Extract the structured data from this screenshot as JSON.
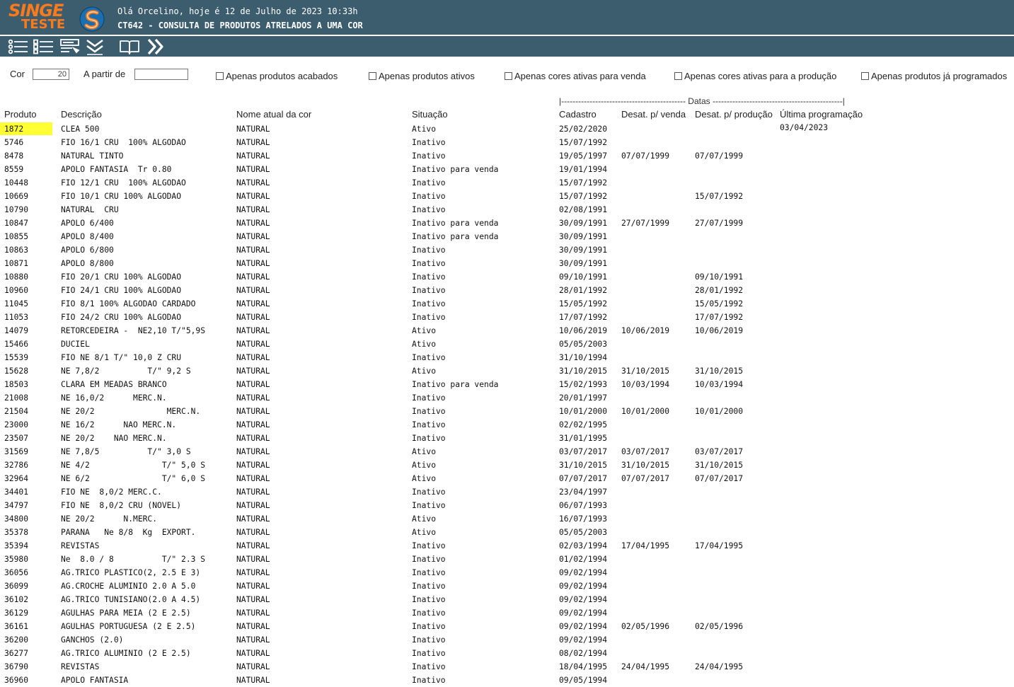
{
  "header": {
    "logo_top": "SINGE",
    "logo_bottom": "TESTE",
    "greeting": "Olá Orcelino, hoje é 12 de Julho de 2023 10:33h",
    "screen_title": "CT642 - CONSULTA DE PRODUTOS ATRELADOS A UMA COR"
  },
  "toolbar": {
    "buttons": [
      "list-icon",
      "checklist-icon",
      "form-icon",
      "double-down-icon",
      "book-icon",
      "forward-icon"
    ]
  },
  "filters": {
    "cor_label": "Cor",
    "cor_value": "20",
    "apartir_label": "A partir de",
    "apartir_value": "",
    "checkboxes": [
      "Apenas produtos acabados",
      "Apenas produtos ativos",
      "Apenas cores ativas para venda",
      "Apenas cores ativas para a produção",
      "Apenas produtos já programados"
    ]
  },
  "table": {
    "datas_group": "|-------------------------------------------- Datas ----------------------------------------------|",
    "headers": [
      "Produto",
      "Descrição",
      "Nome atual da cor",
      "Situação",
      "Cadastro",
      "Desat. p/ venda",
      "Desat. p/ produção",
      "Última programação"
    ],
    "rows": [
      [
        "1872",
        "CLEA 500",
        "NATURAL",
        "Ativo",
        "25/02/2020",
        "",
        "",
        "03/04/2023"
      ],
      [
        "5746",
        "FIO 16/1 CRU  100% ALGODAO",
        "NATURAL",
        "Inativo",
        "15/07/1992",
        "",
        "",
        ""
      ],
      [
        "8478",
        "NATURAL TINTO",
        "NATURAL",
        "Inativo",
        "19/05/1997",
        "07/07/1999",
        "07/07/1999",
        ""
      ],
      [
        "8559",
        "APOLO FANTASIA  Tr 0.80",
        "NATURAL",
        "Inativo para venda",
        "19/01/1994",
        "",
        "",
        ""
      ],
      [
        "10448",
        "FIO 12/1 CRU  100% ALGODAO",
        "NATURAL",
        "Inativo",
        "15/07/1992",
        "",
        "",
        ""
      ],
      [
        "10669",
        "FIO 10/1 CRU 100% ALGODAO",
        "NATURAL",
        "Inativo",
        "15/07/1992",
        "",
        "15/07/1992",
        ""
      ],
      [
        "10790",
        "NATURAL  CRU",
        "NATURAL",
        "Inativo",
        "02/08/1991",
        "",
        "",
        ""
      ],
      [
        "10847",
        "APOLO 6/400",
        "NATURAL",
        "Inativo para venda",
        "30/09/1991",
        "27/07/1999",
        "27/07/1999",
        ""
      ],
      [
        "10855",
        "APOLO 8/400",
        "NATURAL",
        "Inativo para venda",
        "30/09/1991",
        "",
        "",
        ""
      ],
      [
        "10863",
        "APOLO 6/800",
        "NATURAL",
        "Inativo",
        "30/09/1991",
        "",
        "",
        ""
      ],
      [
        "10871",
        "APOLO 8/800",
        "NATURAL",
        "Inativo",
        "30/09/1991",
        "",
        "",
        ""
      ],
      [
        "10880",
        "FIO 20/1 CRU 100% ALGODAO",
        "NATURAL",
        "Inativo",
        "09/10/1991",
        "",
        "09/10/1991",
        ""
      ],
      [
        "10960",
        "FIO 24/1 CRU 100% ALGODAO",
        "NATURAL",
        "Inativo",
        "28/01/1992",
        "",
        "28/01/1992",
        ""
      ],
      [
        "11045",
        "FIO 8/1 100% ALGODAO CARDADO",
        "NATURAL",
        "Inativo",
        "15/05/1992",
        "",
        "15/05/1992",
        ""
      ],
      [
        "11053",
        "FIO 24/2 CRU 100% ALGODAO",
        "NATURAL",
        "Inativo",
        "17/07/1992",
        "",
        "17/07/1992",
        ""
      ],
      [
        "14079",
        "RETORCEDEIRA -  NE2,10 T/\"5,9S",
        "NATURAL",
        "Ativo",
        "10/06/2019",
        "10/06/2019",
        "10/06/2019",
        ""
      ],
      [
        "15466",
        "DUCIEL",
        "NATURAL",
        "Ativo",
        "05/05/2003",
        "",
        "",
        ""
      ],
      [
        "15539",
        "FIO NE 8/1 T/\" 10,0 Z CRU",
        "NATURAL",
        "Inativo",
        "31/10/1994",
        "",
        "",
        ""
      ],
      [
        "15628",
        "NE 7,8/2          T/\" 9,2 S",
        "NATURAL",
        "Ativo",
        "31/10/2015",
        "31/10/2015",
        "31/10/2015",
        ""
      ],
      [
        "18503",
        "CLARA EM MEADAS BRANCO",
        "NATURAL",
        "Inativo para venda",
        "15/02/1993",
        "10/03/1994",
        "10/03/1994",
        ""
      ],
      [
        "21008",
        "NE 16,0/2      MERC.N.",
        "NATURAL",
        "Inativo",
        "20/01/1997",
        "",
        "",
        ""
      ],
      [
        "21504",
        "NE 20/2               MERC.N.",
        "NATURAL",
        "Inativo",
        "10/01/2000",
        "10/01/2000",
        "10/01/2000",
        ""
      ],
      [
        "23000",
        "NE 16/2      NAO MERC.N.",
        "NATURAL",
        "Inativo",
        "02/02/1995",
        "",
        "",
        ""
      ],
      [
        "23507",
        "NE 20/2    NAO MERC.N.",
        "NATURAL",
        "Inativo",
        "31/01/1995",
        "",
        "",
        ""
      ],
      [
        "31569",
        "NE 7,8/5          T/\" 3,0 S",
        "NATURAL",
        "Ativo",
        "03/07/2017",
        "03/07/2017",
        "03/07/2017",
        ""
      ],
      [
        "32786",
        "NE 4/2               T/\" 5,0 S",
        "NATURAL",
        "Ativo",
        "31/10/2015",
        "31/10/2015",
        "31/10/2015",
        ""
      ],
      [
        "32964",
        "NE 6/2               T/\" 6,0 S",
        "NATURAL",
        "Ativo",
        "07/07/2017",
        "07/07/2017",
        "07/07/2017",
        ""
      ],
      [
        "34401",
        "FIO NE  8,0/2 MERC.C.",
        "NATURAL",
        "Inativo",
        "23/04/1997",
        "",
        "",
        ""
      ],
      [
        "34797",
        "FIO NE  8,0/2 CRU (NOVEL)",
        "NATURAL",
        "Inativo",
        "06/07/1993",
        "",
        "",
        ""
      ],
      [
        "34800",
        "NE 20/2      N.MERC.",
        "NATURAL",
        "Ativo",
        "16/07/1993",
        "",
        "",
        ""
      ],
      [
        "35378",
        "PARANA   Ne 8/8  Kg  EXPORT.",
        "NATURAL",
        "Ativo",
        "05/05/2003",
        "",
        "",
        ""
      ],
      [
        "35394",
        "REVISTAS",
        "NATURAL",
        "Inativo",
        "02/03/1994",
        "17/04/1995",
        "17/04/1995",
        ""
      ],
      [
        "35980",
        "Ne  8.0 / 8          T/\" 2.3 S",
        "NATURAL",
        "Inativo",
        "01/02/1994",
        "",
        "",
        ""
      ],
      [
        "36056",
        "AG.TRICO PLASTICO(2, 2.5 E 3)",
        "NATURAL",
        "Inativo",
        "09/02/1994",
        "",
        "",
        ""
      ],
      [
        "36099",
        "AG.CROCHE ALUMINIO 2.0 A 5.0",
        "NATURAL",
        "Inativo",
        "09/02/1994",
        "",
        "",
        ""
      ],
      [
        "36102",
        "AG.TRICO TUNISIANO(2.0 A 4.5)",
        "NATURAL",
        "Inativo",
        "09/02/1994",
        "",
        "",
        ""
      ],
      [
        "36129",
        "AGULHAS PARA MEIA (2 E 2.5)",
        "NATURAL",
        "Inativo",
        "09/02/1994",
        "",
        "",
        ""
      ],
      [
        "36161",
        "AGULHAS PORTUGUESA (2 E 2.5)",
        "NATURAL",
        "Inativo",
        "09/02/1994",
        "02/05/1996",
        "02/05/1996",
        ""
      ],
      [
        "36200",
        "GANCHOS (2.0)",
        "NATURAL",
        "Inativo",
        "09/02/1994",
        "",
        "",
        ""
      ],
      [
        "36277",
        "AG.TRICO ALUMINIO (2 E 2.5)",
        "NATURAL",
        "Inativo",
        "08/02/1994",
        "",
        "",
        ""
      ],
      [
        "36790",
        "REVISTAS",
        "NATURAL",
        "Inativo",
        "18/04/1995",
        "24/04/1995",
        "24/04/1995",
        ""
      ],
      [
        "36960",
        "APOLO FANTASIA",
        "NATURAL",
        "Inativo",
        "09/05/1994",
        "",
        "",
        ""
      ]
    ]
  },
  "colors": {
    "header_bg": "#3c5d6e",
    "logo_orange": "#ff7a1a",
    "highlight": "#ffff33"
  }
}
